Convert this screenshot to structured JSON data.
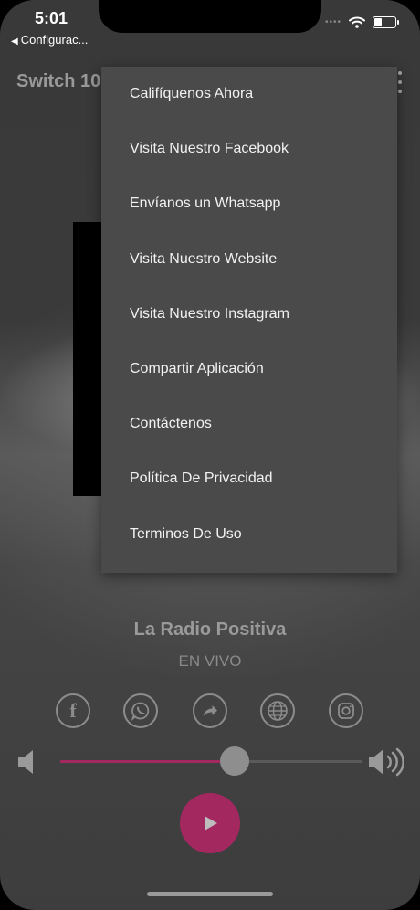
{
  "status_bar": {
    "time": "5:01",
    "back_label": "Configurac..."
  },
  "app": {
    "title": "Switch 10"
  },
  "menu": {
    "items": [
      {
        "label": "Califíquenos Ahora"
      },
      {
        "label": "Visita Nuestro Facebook"
      },
      {
        "label": "Envíanos un Whatsapp"
      },
      {
        "label": "Visita Nuestro Website"
      },
      {
        "label": "Visita Nuestro Instagram"
      },
      {
        "label": "Compartir Aplicación"
      },
      {
        "label": "Contáctenos"
      },
      {
        "label": "Política De Privacidad"
      },
      {
        "label": "Terminos De Uso"
      }
    ]
  },
  "player": {
    "station_name": "La Radio Positiva",
    "status": "EN VIVO",
    "volume_level": 0.58
  },
  "social_icons": [
    "facebook-icon",
    "whatsapp-icon",
    "share-icon",
    "globe-icon",
    "instagram-icon"
  ],
  "colors": {
    "accent": "#a3285f",
    "menu_bg": "#4a4a4a"
  }
}
